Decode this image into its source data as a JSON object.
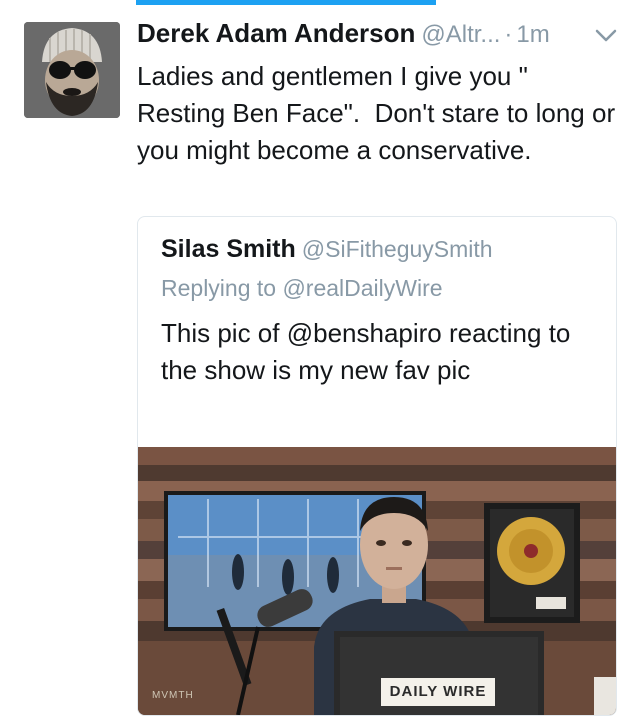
{
  "tweet": {
    "author_name": "Derek Adam Anderson",
    "author_handle": "@Altr...",
    "separator": "·",
    "timestamp": "1m",
    "text": "Ladies and gentlemen I give you \" Resting Ben Face\".  Don't stare to long or you might become a conservative."
  },
  "quoted_tweet": {
    "author_name": "Silas Smith",
    "author_handle": "@SiFitheguySmith",
    "replying_to": "Replying to @realDailyWire",
    "text": "This pic of @benshapiro reacting to the show is my new fav pic",
    "photo": {
      "desk_sign": "DAILY WIRE",
      "corner_mark": "MVMTH"
    }
  },
  "icons": {
    "caret": "chevron-down-icon"
  },
  "colors": {
    "accent": "#1da1f2",
    "secondary_text": "#8899a6",
    "border": "#e1e8ed"
  }
}
